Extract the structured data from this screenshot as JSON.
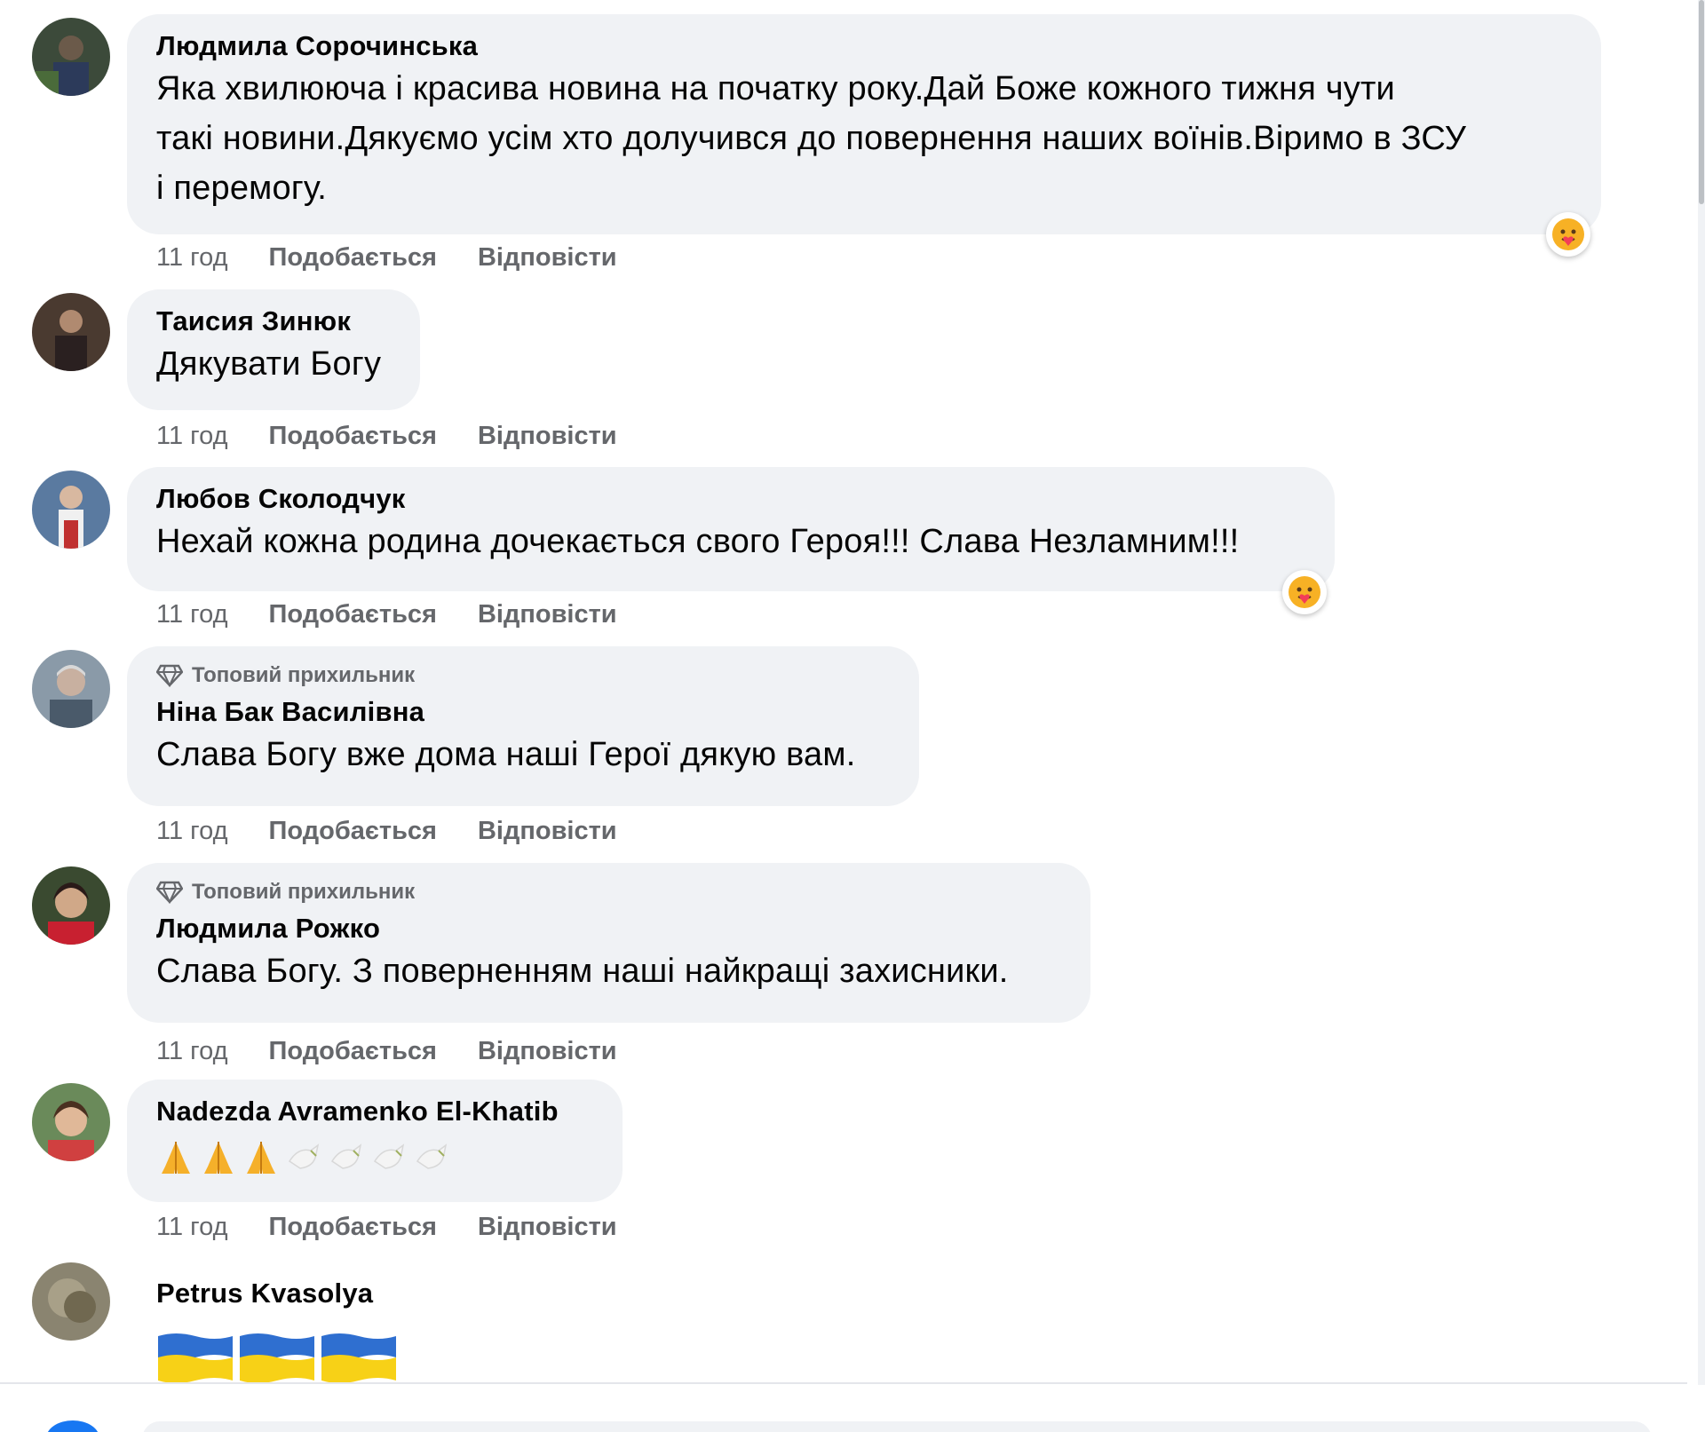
{
  "comments": [
    {
      "name": "Людмила Сорочинська",
      "lines": [
        "Яка хвилююча і красива новина на початку року.Дай Боже кожного тижня чути",
        "такі новини.Дякуємо усім хто долучився до повернення наших воїнів.Віримо в ЗСУ",
        "і перемогу."
      ],
      "time": "11 год",
      "like": "Подобається",
      "reply": "Відповісти",
      "reaction": "care-icon"
    },
    {
      "name": "Таисия Зинюк",
      "lines": [
        "Дякувати Богу"
      ],
      "time": "11 год",
      "like": "Подобається",
      "reply": "Відповісти"
    },
    {
      "name": "Любов Сколодчук",
      "lines": [
        "Нехай кожна родина дочекається свого Героя!!! Слава Незламним!!!"
      ],
      "time": "11 год",
      "like": "Подобається",
      "reply": "Відповісти",
      "reaction": "care-icon"
    },
    {
      "badge": "Топовий прихильник",
      "name": "Ніна Бак Василівна",
      "lines": [
        "Слава Богу вже дома наші Герої дякую вам."
      ],
      "time": "11 год",
      "like": "Подобається",
      "reply": "Відповісти"
    },
    {
      "badge": "Топовий прихильник",
      "name": "Людмила Рожко",
      "lines": [
        "Слава Богу. З поверненням наші найкращі захисники."
      ],
      "time": "11 год",
      "like": "Подобається",
      "reply": "Відповісти"
    },
    {
      "name": "Nadezda Avramenko El-Khatib",
      "emojis": [
        "folded-hands-icon",
        "folded-hands-icon",
        "folded-hands-icon",
        "dove-icon",
        "dove-icon",
        "dove-icon",
        "dove-icon"
      ],
      "time": "11 год",
      "like": "Подобається",
      "reply": "Відповісти"
    },
    {
      "name": "Petrus Kvasolya",
      "emojis": [
        "ukraine-flag-icon",
        "ukraine-flag-icon",
        "ukraine-flag-icon"
      ]
    }
  ],
  "colors": {
    "bubble": "#f0f2f5",
    "text": "#050505",
    "secondary": "#65676b",
    "flag_blue": "#2f6fd0",
    "flag_yellow": "#f7d117"
  }
}
